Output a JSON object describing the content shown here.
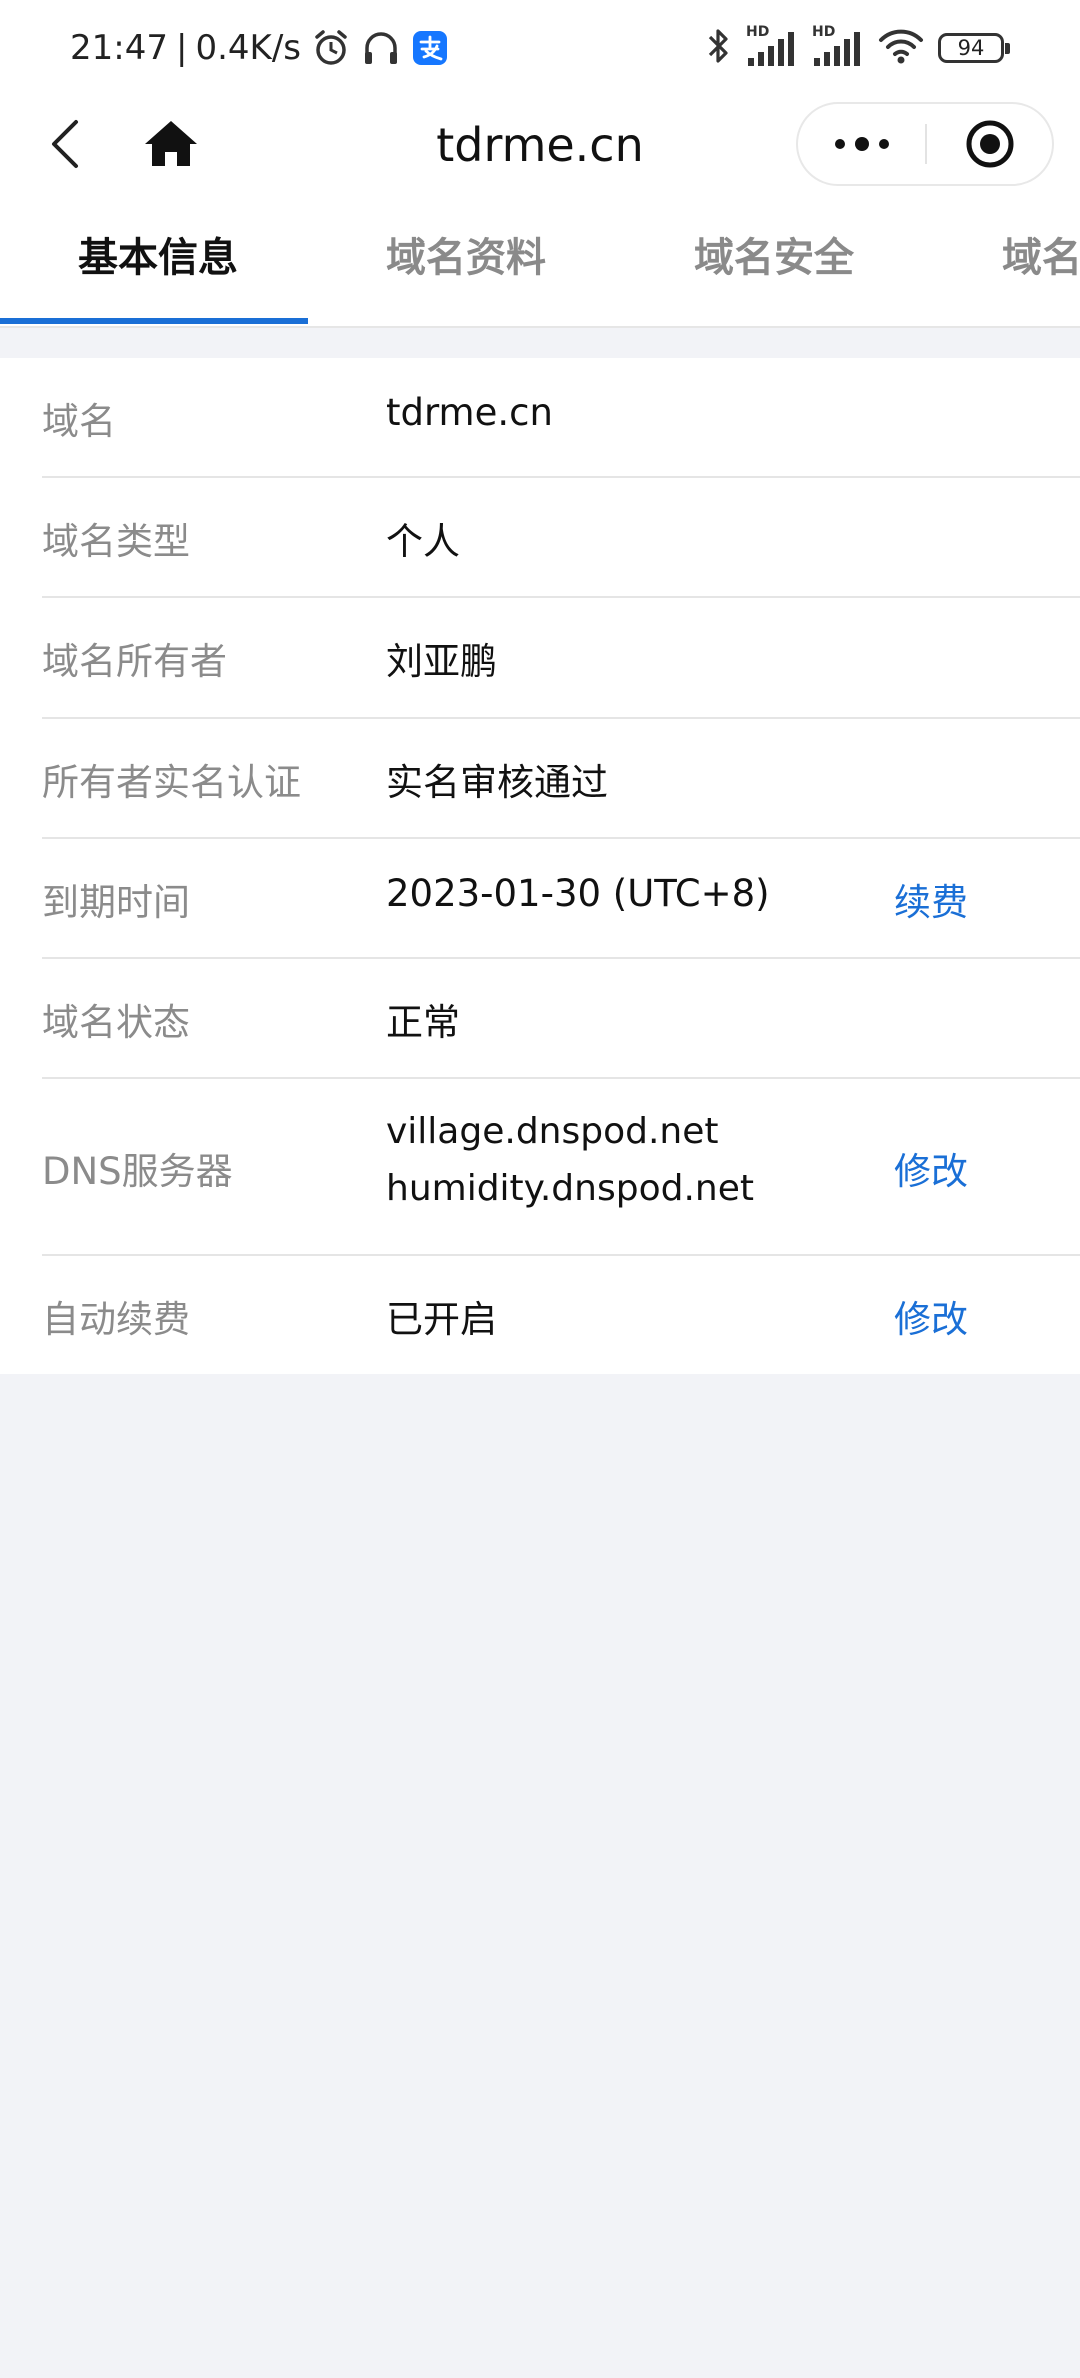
{
  "status_bar": {
    "time": "21:47",
    "separator": "|",
    "speed": "0.4K/s",
    "signal_label_1": "HD",
    "signal_label_2": "HD",
    "battery": "94",
    "icons": [
      "alarm-icon",
      "headset-icon",
      "alipay-icon",
      "bluetooth-icon",
      "signal-icon",
      "wifi-icon",
      "battery-icon"
    ]
  },
  "nav": {
    "title": "tdrme.cn"
  },
  "tabs": [
    {
      "label": "基本信息",
      "active": true
    },
    {
      "label": "域名资料",
      "active": false
    },
    {
      "label": "域名安全",
      "active": false
    },
    {
      "label": "域名",
      "active": false
    }
  ],
  "rows": [
    {
      "label": "域名",
      "value": "tdrme.cn"
    },
    {
      "label": "域名类型",
      "value": "个人"
    },
    {
      "label": "域名所有者",
      "value": "刘亚鹏"
    },
    {
      "label": "所有者实名认证",
      "value": "实名审核通过"
    },
    {
      "label": "到期时间",
      "value": "2023-01-30 (UTC+8)",
      "action": "续费"
    },
    {
      "label": "域名状态",
      "value": "正常"
    },
    {
      "label": "DNS服务器",
      "values": [
        "village.dnspod.net",
        "humidity.dnspod.net"
      ],
      "action": "修改"
    },
    {
      "label": "自动续费",
      "value": "已开启",
      "action": "修改"
    }
  ],
  "colors": {
    "accent": "#1a6fd6",
    "background": "#f2f3f7",
    "label_gray": "#8b8b8b"
  }
}
